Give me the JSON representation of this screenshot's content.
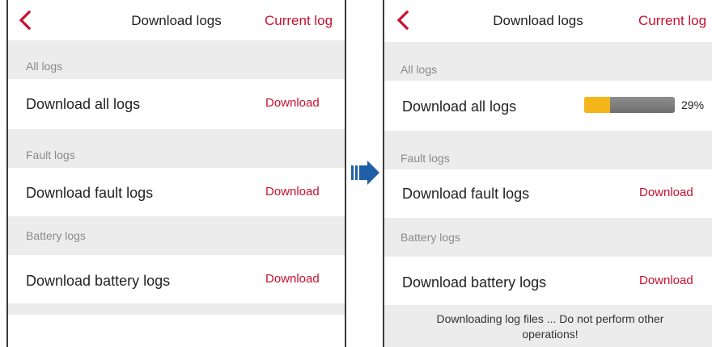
{
  "screens": [
    {
      "header": {
        "title": "Download logs",
        "current_log": "Current log"
      },
      "sections": [
        {
          "label": "All logs",
          "item": "Download all logs",
          "action": "Download"
        },
        {
          "label": "Fault logs",
          "item": "Download fault logs",
          "action": "Download"
        },
        {
          "label": "Battery logs",
          "item": "Download battery logs",
          "action": "Download"
        }
      ]
    },
    {
      "header": {
        "title": "Download logs",
        "current_log": "Current log"
      },
      "sections": [
        {
          "label": "All logs",
          "item": "Download all logs",
          "progress_percent": "29%",
          "progress_fraction": 0.29
        },
        {
          "label": "Fault logs",
          "item": "Download fault logs",
          "action": "Download"
        },
        {
          "label": "Battery logs",
          "item": "Download battery logs",
          "action": "Download"
        }
      ],
      "notice": "Downloading log files ... Do not perform other operations!"
    }
  ],
  "colors": {
    "accent": "#c8102e",
    "section_bg": "#ececec",
    "progress_fill": "#f4b51b",
    "progress_track": "#7e7e7e",
    "arrow": "#1f5fa6"
  },
  "icons": {
    "back": "chevron-left-icon",
    "transition": "right-arrow-icon"
  }
}
